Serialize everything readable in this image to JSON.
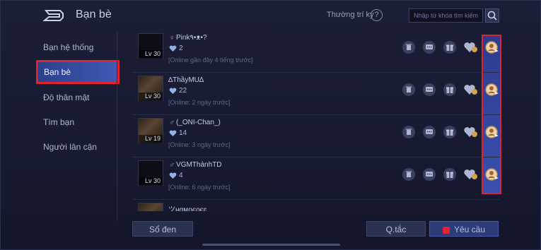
{
  "header": {
    "title": "Bạn bè",
    "notify_label": "Thường trí ký",
    "search_placeholder": "Nhập từ khóa tìm kiếm"
  },
  "sidebar": {
    "items": [
      {
        "label": "Bạn hệ thống"
      },
      {
        "label": "Bạn bè"
      },
      {
        "label": "Độ thân mật"
      },
      {
        "label": "Tìm bạn"
      },
      {
        "label": "Người lân cận"
      }
    ]
  },
  "friends": [
    {
      "name": "Pink٩•ᴥ•?",
      "level": "Lv 30",
      "hearts": "2",
      "status": "[Online gần đây 4 tiếng trước]",
      "gender": "♀"
    },
    {
      "name": "∆ThầyMU∆",
      "level": "Lv 30",
      "hearts": "22",
      "status": "[Online: 2 ngày trước]",
      "gender": ""
    },
    {
      "name": "(_ONI-Chan_)",
      "level": "Lv 19",
      "hearts": "14",
      "status": "[Online: 3 ngày trước]",
      "gender": "♂"
    },
    {
      "name": "VGMThànhTD",
      "level": "Lv 30",
      "hearts": "4",
      "status": "[Online: 6 ngày trước]",
      "gender": "♂"
    },
    {
      "name": "ツнαмρєρєɛ"
    }
  ],
  "footer": {
    "blacklist_label": "Sổ đen",
    "rules_label": "Q.tắc",
    "requests_label": "Yêu cầu"
  },
  "colors": {
    "highlight_red": "#e0242f",
    "active_blue": "#3f5ab5",
    "background": "#171a31"
  }
}
